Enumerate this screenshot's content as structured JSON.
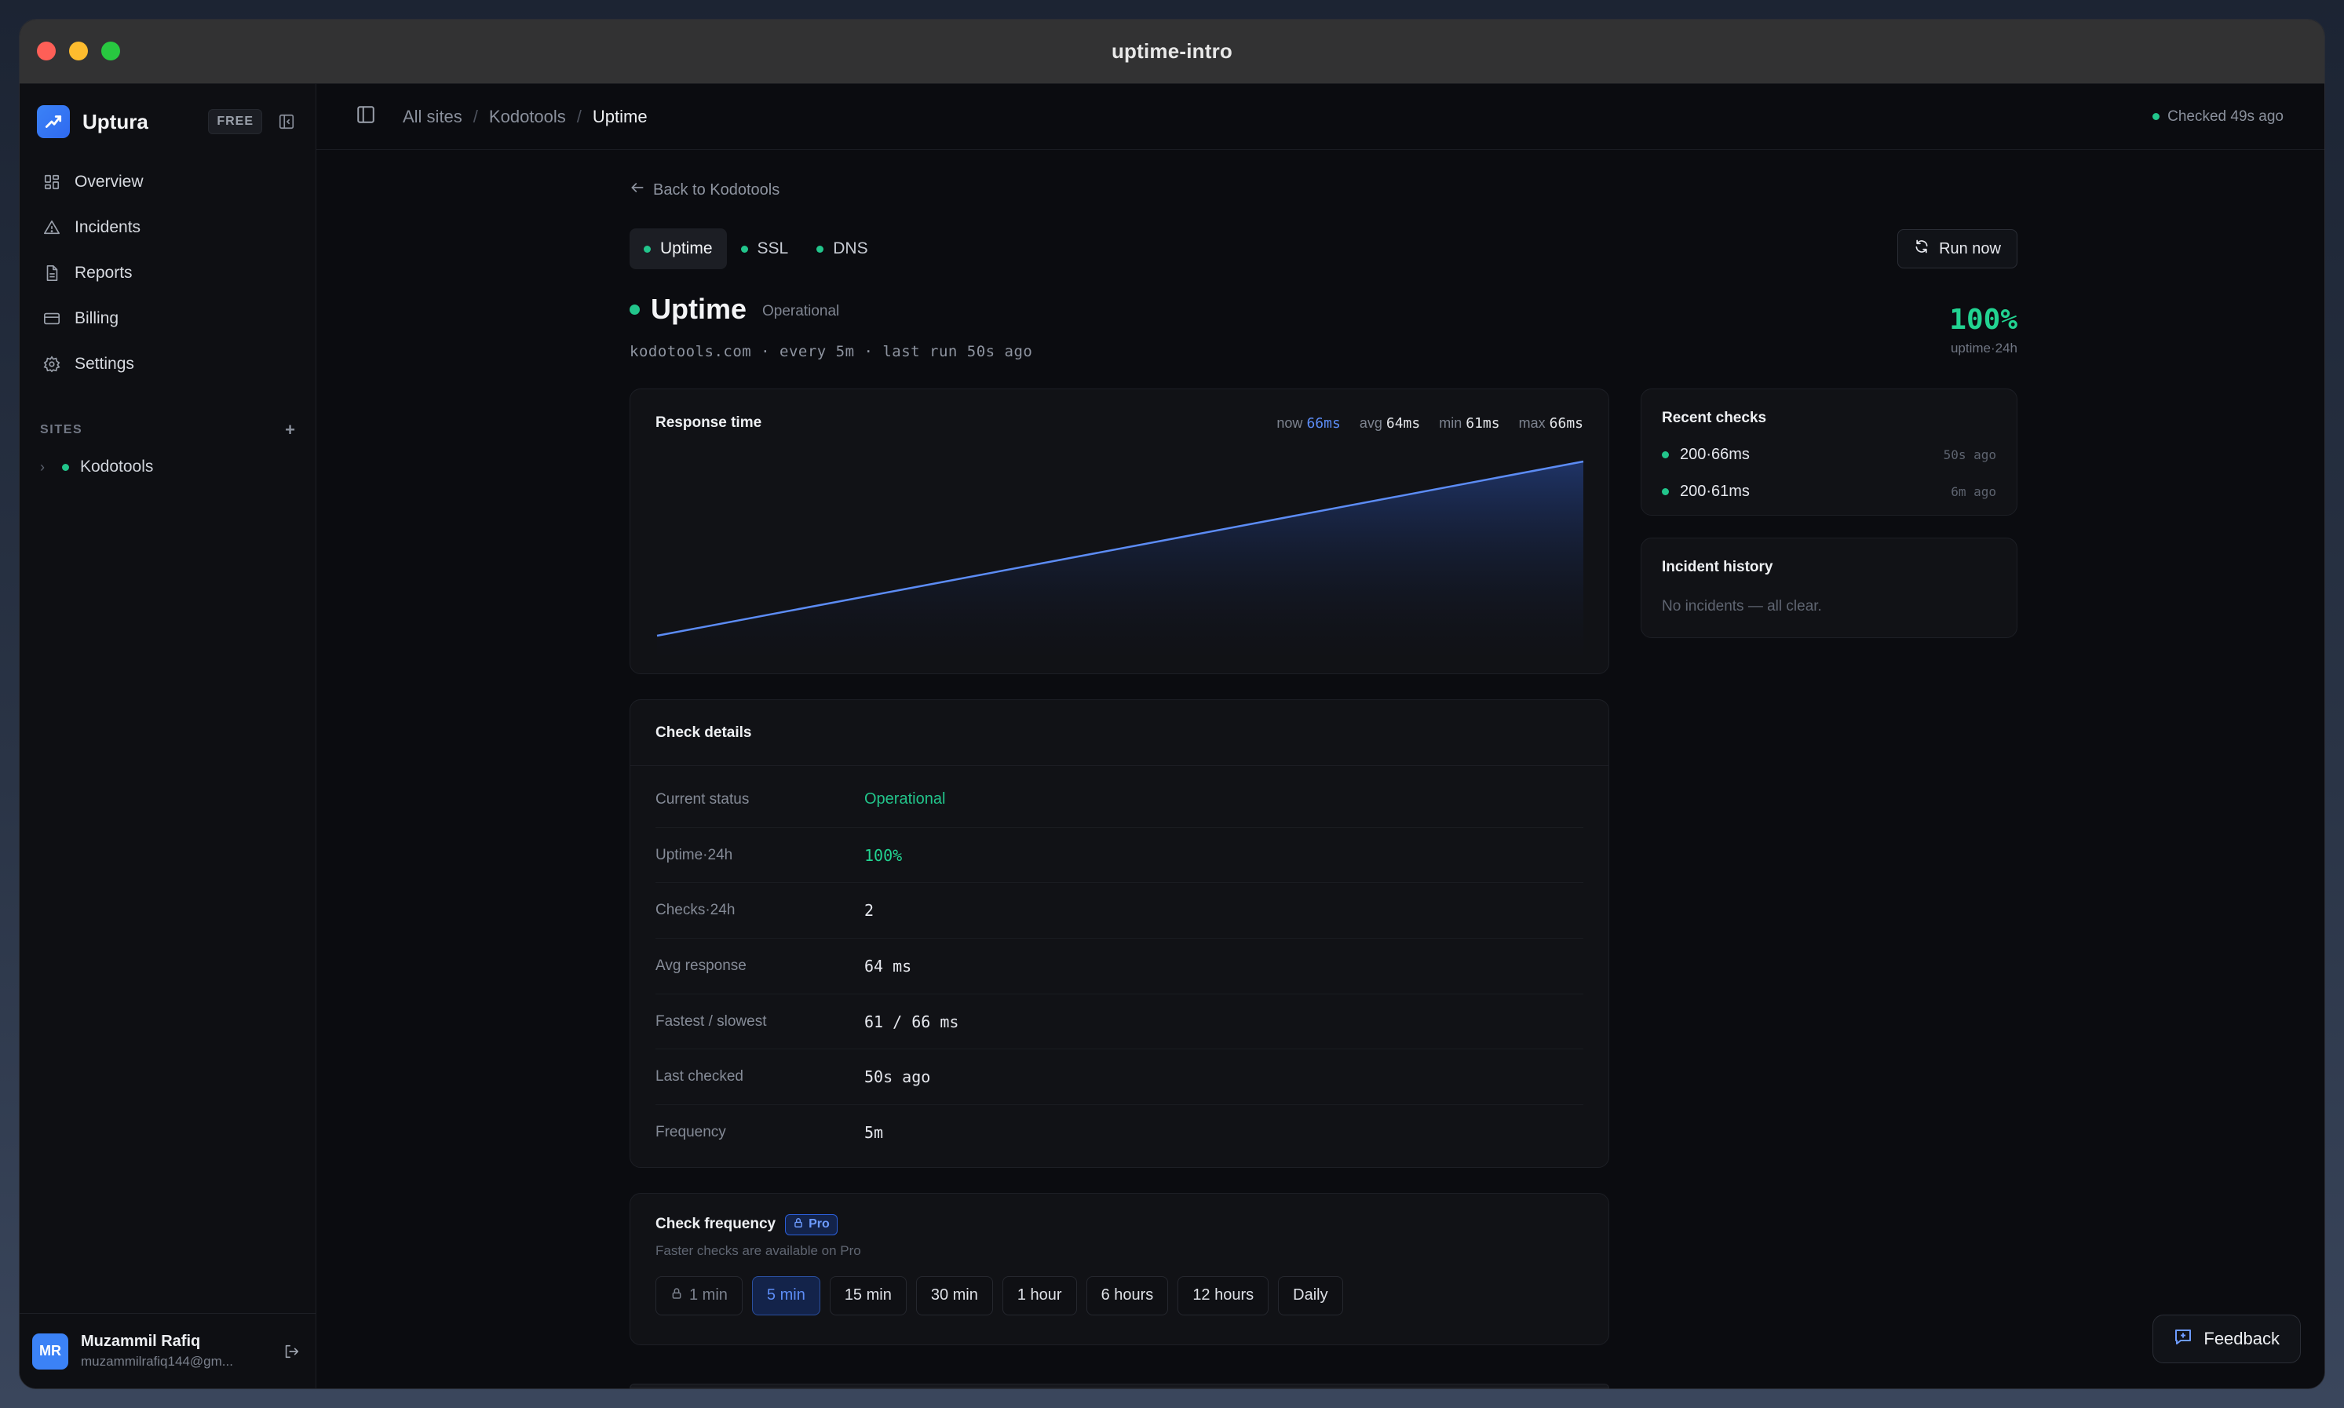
{
  "window": {
    "title": "uptime-intro"
  },
  "brand": {
    "name": "Uptura",
    "plan": "FREE"
  },
  "nav": [
    {
      "label": "Overview",
      "icon": "grid-icon"
    },
    {
      "label": "Incidents",
      "icon": "warning-icon"
    },
    {
      "label": "Reports",
      "icon": "document-icon"
    },
    {
      "label": "Billing",
      "icon": "card-icon"
    },
    {
      "label": "Settings",
      "icon": "gear-icon"
    }
  ],
  "sites": {
    "heading": "SITES",
    "items": [
      {
        "label": "Kodotools",
        "status": "up"
      }
    ]
  },
  "user": {
    "initials": "MR",
    "name": "Muzammil Rafiq",
    "email": "muzammilrafiq144@gm..."
  },
  "breadcrumb": {
    "root": "All sites",
    "site": "Kodotools",
    "current": "Uptime"
  },
  "topbar": {
    "checked": "Checked 49s ago"
  },
  "back": {
    "label": "Back to Kodotools"
  },
  "tabs": [
    {
      "label": "Uptime",
      "active": true
    },
    {
      "label": "SSL",
      "active": false
    },
    {
      "label": "DNS",
      "active": false
    }
  ],
  "run_now": "Run now",
  "header": {
    "title": "Uptime",
    "status": "Operational",
    "meta": "kodotools.com · every 5m · last run 50s ago",
    "uptime_value": "100%",
    "uptime_label": "uptime·24h"
  },
  "response": {
    "title": "Response time",
    "now_label": "now",
    "now_value": "66ms",
    "avg_label": "avg",
    "avg_value": "64ms",
    "min_label": "min",
    "min_value": "61ms",
    "max_label": "max",
    "max_value": "66ms"
  },
  "chart_data": {
    "type": "area",
    "title": "Response time",
    "x": [
      0,
      1
    ],
    "series": [
      {
        "values": [
          61,
          66
        ]
      }
    ],
    "ylim": [
      61,
      66
    ],
    "grid": false,
    "colors": {
      "line": "#5c8cf5",
      "fill": "#1e3a7a"
    }
  },
  "details": {
    "title": "Check details",
    "rows": [
      {
        "key": "Current status",
        "value": "Operational",
        "style": "green"
      },
      {
        "key": "Uptime·24h",
        "value": "100%",
        "style": "greenmono"
      },
      {
        "key": "Checks·24h",
        "value": "2",
        "style": "mono"
      },
      {
        "key": "Avg response",
        "value": "64 ms",
        "style": "mono"
      },
      {
        "key": "Fastest / slowest",
        "value": "61 / 66 ms",
        "style": "mono"
      },
      {
        "key": "Last checked",
        "value": "50s ago",
        "style": "mono"
      },
      {
        "key": "Frequency",
        "value": "5m",
        "style": "mono"
      }
    ]
  },
  "frequency": {
    "title": "Check frequency",
    "pro_badge": "Pro",
    "subtitle": "Faster checks are available on Pro",
    "options": [
      {
        "label": "1 min",
        "state": "locked"
      },
      {
        "label": "5 min",
        "state": "selected"
      },
      {
        "label": "15 min",
        "state": "normal"
      },
      {
        "label": "30 min",
        "state": "normal"
      },
      {
        "label": "1 hour",
        "state": "normal"
      },
      {
        "label": "6 hours",
        "state": "normal"
      },
      {
        "label": "12 hours",
        "state": "normal"
      },
      {
        "label": "Daily",
        "state": "normal"
      }
    ]
  },
  "recent": {
    "title": "Recent checks",
    "items": [
      {
        "label": "200·66ms",
        "when": "50s ago"
      },
      {
        "label": "200·61ms",
        "when": "6m ago"
      }
    ]
  },
  "incidents": {
    "title": "Incident history",
    "empty": "No incidents — all clear."
  },
  "feedback": {
    "label": "Feedback"
  },
  "colors": {
    "accent": "#3b82f6",
    "success": "#22c58b",
    "background": "#0b0c10"
  }
}
